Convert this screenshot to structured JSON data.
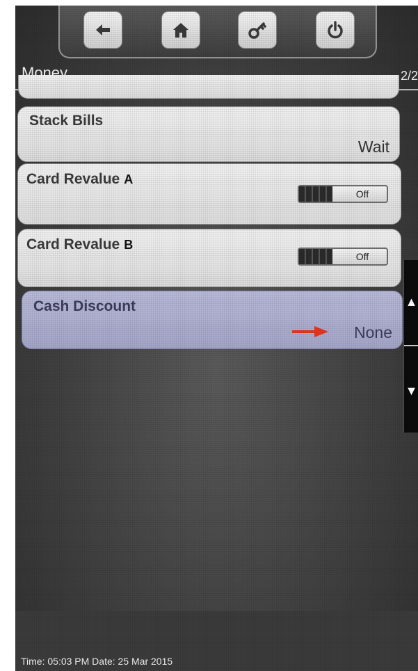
{
  "header": {
    "title": "Money",
    "page": "2/2",
    "buttons": [
      {
        "name": "back",
        "icon": "arrow-left-icon"
      },
      {
        "name": "home",
        "icon": "home-icon"
      },
      {
        "name": "key",
        "icon": "key-icon"
      },
      {
        "name": "power",
        "icon": "power-icon"
      }
    ]
  },
  "settings": [
    {
      "label": "Stack Bills",
      "value": "Wait"
    },
    {
      "label": "Card Revalue",
      "suffix": "A",
      "toggle": "Off"
    },
    {
      "label": "Card Revalue",
      "suffix": "B",
      "toggle": "Off"
    },
    {
      "label": "Cash Discount",
      "value": "None",
      "selected": true
    }
  ],
  "scroll": {
    "up_icon": "scroll-up-icon",
    "down_icon": "scroll-down-icon"
  },
  "footer": {
    "status": "Time: 05:03 PM Date: 25 Mar 2015"
  },
  "colors": {
    "selected_row": "#a9a9cc",
    "arrow": "#e8351e",
    "screen_bg": "#454545"
  }
}
